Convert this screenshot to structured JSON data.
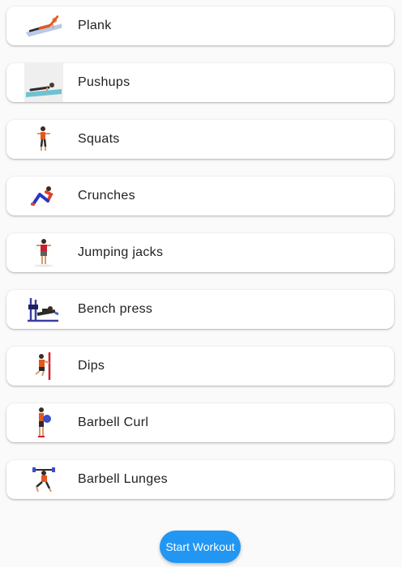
{
  "exercises": [
    {
      "label": "Plank",
      "icon": "plank-icon"
    },
    {
      "label": "Pushups",
      "icon": "pushups-icon"
    },
    {
      "label": "Squats",
      "icon": "squats-icon"
    },
    {
      "label": "Crunches",
      "icon": "crunches-icon"
    },
    {
      "label": "Jumping jacks",
      "icon": "jumping-jacks-icon"
    },
    {
      "label": "Bench press",
      "icon": "bench-press-icon"
    },
    {
      "label": "Dips",
      "icon": "dips-icon"
    },
    {
      "label": "Barbell Curl",
      "icon": "barbell-curl-icon"
    },
    {
      "label": "Barbell Lunges",
      "icon": "barbell-lunges-icon"
    }
  ],
  "start_button": {
    "label": "Start Workout"
  },
  "colors": {
    "accent": "#2196f3",
    "card": "#ffffff",
    "background": "#fafafa",
    "text": "#212121"
  }
}
